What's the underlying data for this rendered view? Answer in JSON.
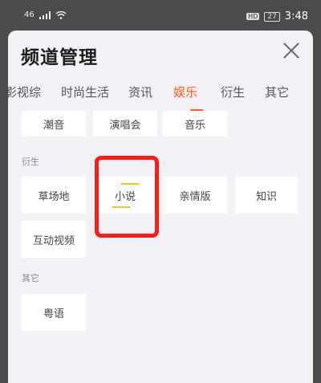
{
  "status_bar": {
    "left": "46",
    "badge": "HD",
    "battery": "27",
    "time": "3:48"
  },
  "sheet": {
    "title": "频道管理",
    "tabs": [
      {
        "label": "影视综"
      },
      {
        "label": "时尚生活"
      },
      {
        "label": "资讯"
      },
      {
        "label": "娱乐"
      },
      {
        "label": "衍生"
      },
      {
        "label": "其它"
      }
    ],
    "active_tab": "娱乐",
    "top_row": [
      "潮音",
      "演唱会",
      "音乐"
    ],
    "sections": [
      {
        "title": "衍生",
        "items": [
          "草场地",
          "小说",
          "亲情版",
          "知识",
          "互动视频"
        ]
      },
      {
        "title": "其它",
        "items": [
          "粤语"
        ]
      }
    ]
  },
  "colors": {
    "accent": "#ff5a1f",
    "highlight": "#ff1a1a",
    "marker": "#f5c518"
  }
}
